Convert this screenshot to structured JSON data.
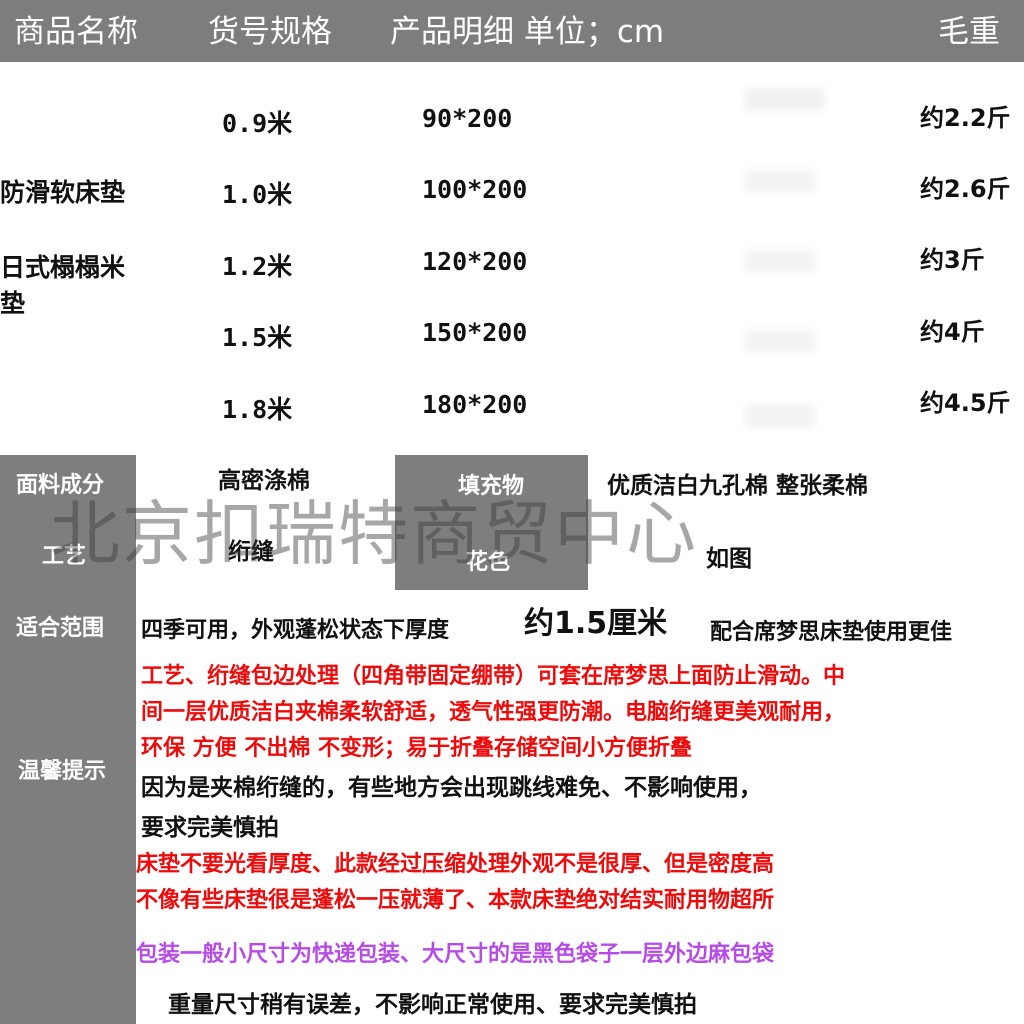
{
  "header": {
    "col_name": "商品名称",
    "col_model": "货号规格",
    "col_detail": "产品明细 单位；cm",
    "col_hidden": "",
    "col_weight": "毛重"
  },
  "product": {
    "name_line1": "防滑软床垫",
    "name_line2": "日式榻榻米",
    "name_line3": "垫"
  },
  "rows": [
    {
      "size": "0.9米",
      "dims": "90*200",
      "weight": "约2.2斤"
    },
    {
      "size": "1.0米",
      "dims": "100*200",
      "weight": "约2.6斤"
    },
    {
      "size": "1.2米",
      "dims": "120*200",
      "weight": "约3斤"
    },
    {
      "size": "1.5米",
      "dims": "150*200",
      "weight": "约4斤"
    },
    {
      "size": "1.8米",
      "dims": "180*200",
      "weight": "约4.5斤"
    }
  ],
  "details": {
    "fabric_label": "面料成分",
    "fabric_value": "高密涤棉",
    "filling_label": "填充物",
    "filling_value": "优质洁白九孔棉 整张柔棉",
    "craft_label": "工艺",
    "craft_value": "绗缝",
    "color_label": "花色",
    "color_value": "如图",
    "scope_label": "适合范围",
    "scope_text_a": "四季可用，外观蓬松状态下厚度",
    "scope_text_b": "约1.5厘米",
    "scope_text_c": "配合席梦思床垫使用更佳",
    "tips_label": "温馨提示"
  },
  "watermark": "北京扣瑞特商贸中心",
  "notes": {
    "red1": "工艺、绗缝包边处理（四角带固定绷带）可套在席梦思上面防止滑动。中",
    "red2": "间一层优质洁白夹棉柔软舒适，透气性强更防潮。电脑绗缝更美观耐用，",
    "red3": "环保 方便 不出棉 不变形；易于折叠存储空间小方便折叠",
    "black1": "因为是夹棉绗缝的，有些地方会出现跳线难免、不影响使用，",
    "black2": "要求完美慎拍",
    "red4": "床垫不要光看厚度、此款经过压缩处理外观不是很厚、但是密度高",
    "red5": "不像有些床垫很是蓬松一压就薄了、本款床垫绝对结实耐用物超所",
    "purple1": "包装一般小尺寸为快递包装、大尺寸的是黑色袋子一层外边麻包袋",
    "black3": "重量尺寸稍有误差，不影响正常使用、要求完美慎拍"
  },
  "colors": {
    "header_bg": "#7d7d7d",
    "red_text": "#ee0a0a",
    "purple_text": "#b64ce6"
  }
}
